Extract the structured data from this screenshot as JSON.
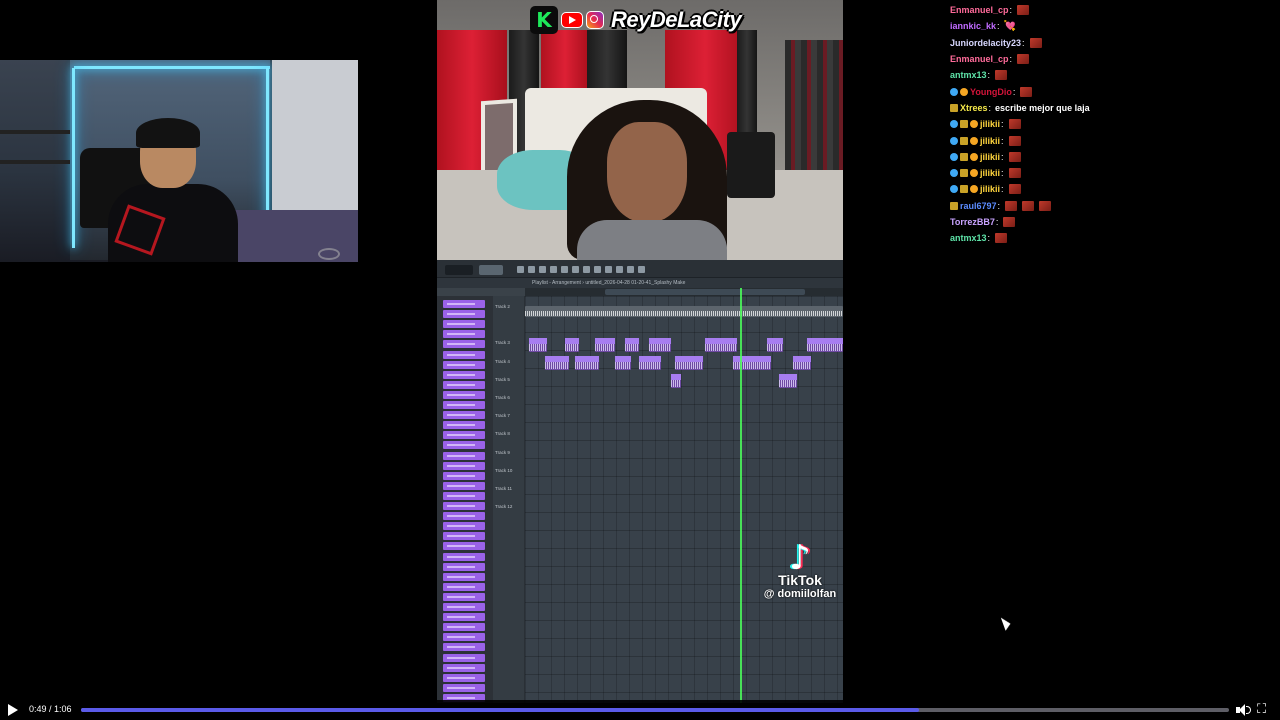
{
  "brand": {
    "name": "ReyDeLaCity",
    "kick_letter": "K"
  },
  "tiktok": {
    "logo": "♪",
    "brand": "TikTok",
    "username": "@ domiilolfan"
  },
  "daw": {
    "title": "Playlist - Arrangement › untitled_2026-04-28 01-20-41_Splashy Make",
    "tracks": [
      "Track 2",
      "",
      "Track 3",
      "Track 4",
      "Track 5",
      "Track 6",
      "Track 7",
      "Track 8",
      "Track 9",
      "Track 10",
      "Track 11",
      "Track 12"
    ]
  },
  "chat": [
    {
      "user": "Enmanuel_cp",
      "color": "#ff6b9a",
      "badges": [],
      "emotes": 1,
      "text": ""
    },
    {
      "user": "iannkic_kk",
      "color": "#c06bff",
      "badges": [],
      "emotes": 0,
      "heart": "💘",
      "text": ""
    },
    {
      "user": "Juniordelacity23",
      "color": "#d7d7ff",
      "badges": [],
      "emotes": 1,
      "text": ""
    },
    {
      "user": "Enmanuel_cp",
      "color": "#ff6b9a",
      "badges": [],
      "emotes": 1,
      "text": ""
    },
    {
      "user": "antmx13",
      "color": "#5ee3a8",
      "badges": [],
      "emotes": 1,
      "text": ""
    },
    {
      "user": "YoungDio",
      "color": "#d4143a",
      "badges": [
        "#3fa9f5",
        "#f5a623"
      ],
      "emotes": 1,
      "text": ""
    },
    {
      "user": "Xtrees",
      "color": "#f5e94a",
      "badges": [
        "#c9a227"
      ],
      "emotes": 0,
      "text": "escribe mejor que laja"
    },
    {
      "user": "jilikii",
      "color": "#ffd53d",
      "badges": [
        "#3fa9f5",
        "#c9a227",
        "#f5a623"
      ],
      "emotes": 1,
      "text": ""
    },
    {
      "user": "jilikii",
      "color": "#ffd53d",
      "badges": [
        "#3fa9f5",
        "#c9a227",
        "#f5a623"
      ],
      "emotes": 1,
      "text": ""
    },
    {
      "user": "jilikii",
      "color": "#ffd53d",
      "badges": [
        "#3fa9f5",
        "#c9a227",
        "#f5a623"
      ],
      "emotes": 1,
      "text": ""
    },
    {
      "user": "jilikii",
      "color": "#ffd53d",
      "badges": [
        "#3fa9f5",
        "#c9a227",
        "#f5a623"
      ],
      "emotes": 1,
      "text": ""
    },
    {
      "user": "jilikii",
      "color": "#ffd53d",
      "badges": [
        "#3fa9f5",
        "#c9a227",
        "#f5a623"
      ],
      "emotes": 1,
      "text": ""
    },
    {
      "user": "raul6797",
      "color": "#5b8cff",
      "badges": [
        "#c9a227"
      ],
      "emotes": 3,
      "text": ""
    },
    {
      "user": "TorrezBB7",
      "color": "#c9a3ff",
      "badges": [],
      "emotes": 1,
      "text": ""
    },
    {
      "user": "antmx13",
      "color": "#5ee3a8",
      "badges": [],
      "emotes": 1,
      "text": ""
    }
  ],
  "player": {
    "time": "0:49 / 1:06",
    "progress": 0.73,
    "accent": "#5b5be8",
    "play_icon": "play-icon",
    "volume_icon": "volume-icon",
    "fullscreen_icon": "fullscreen-icon",
    "fullscreen_glyph": "⛶"
  }
}
